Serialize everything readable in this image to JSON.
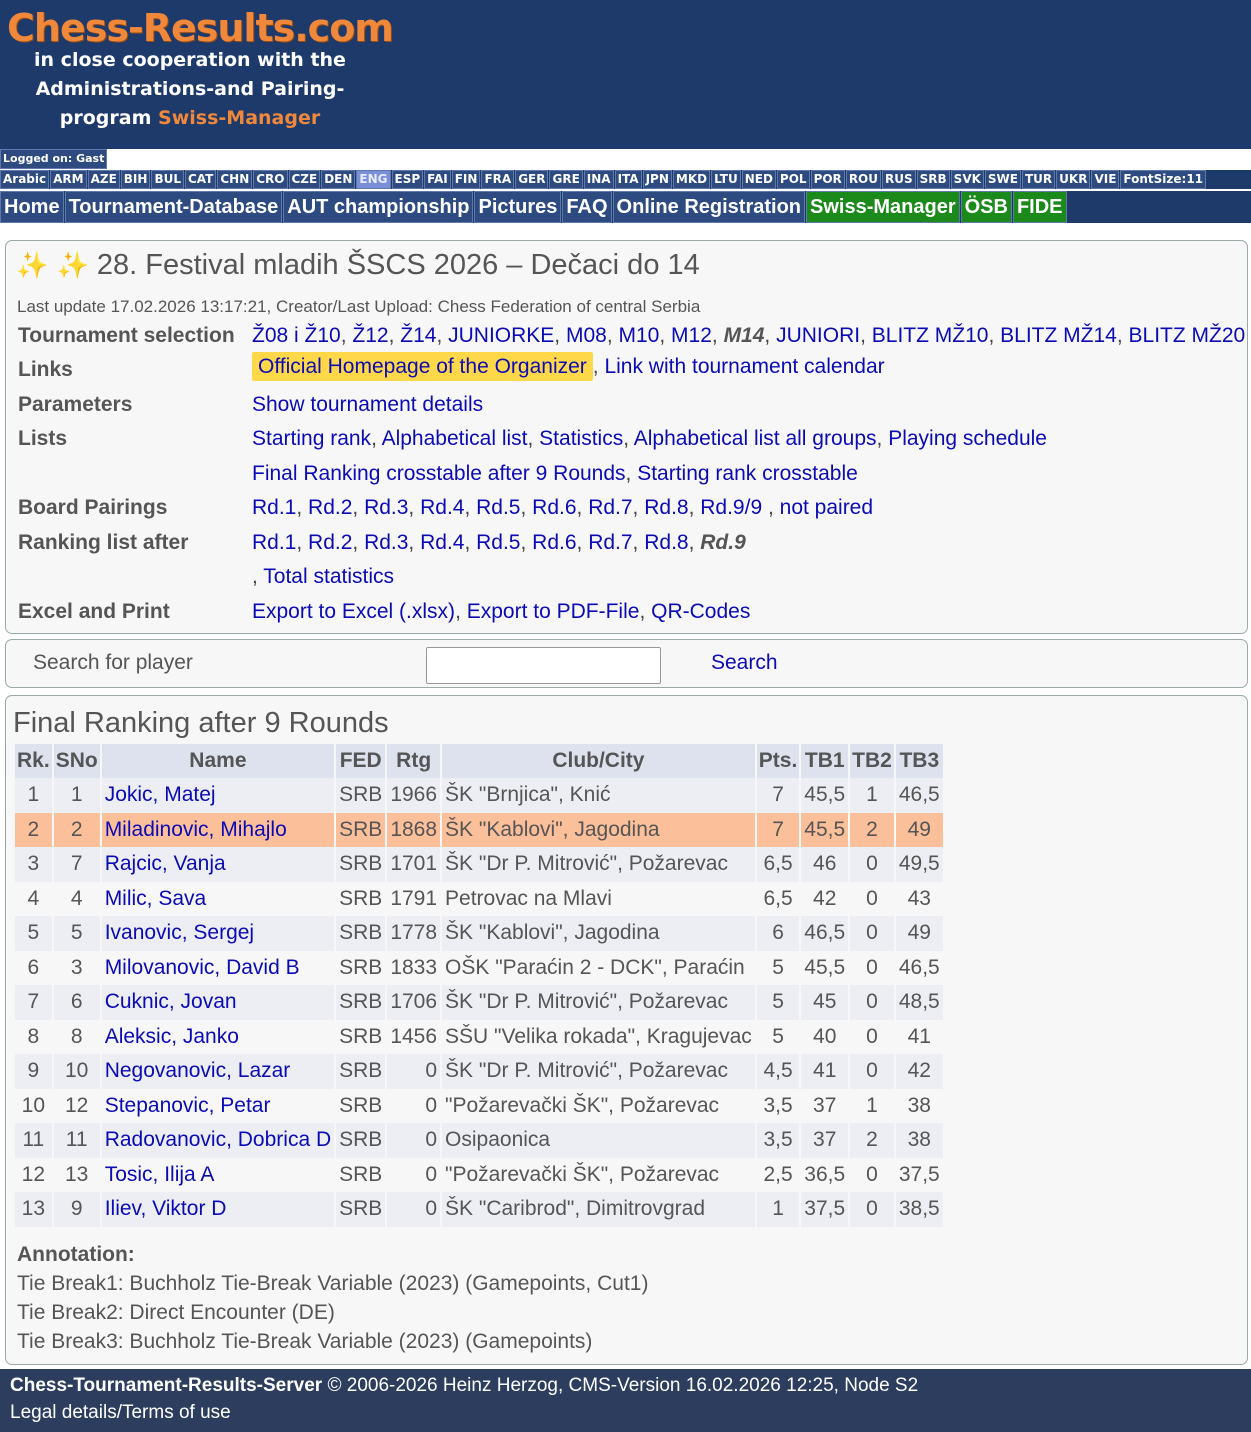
{
  "header": {
    "logo_title": "Chess-Results.com",
    "logo_line1": "in close cooperation with the",
    "logo_line2": "Administrations-and Pairing-",
    "logo_line3a": "program",
    "logo_line3b": "Swiss-Manager"
  },
  "login": "Logged on: Gast",
  "languages": [
    "Arabic",
    "ARM",
    "AZE",
    "BIH",
    "BUL",
    "CAT",
    "CHN",
    "CRO",
    "CZE",
    "DEN",
    "ENG",
    "ESP",
    "FAI",
    "FIN",
    "FRA",
    "GER",
    "GRE",
    "INA",
    "ITA",
    "JPN",
    "MKD",
    "LTU",
    "NED",
    "POL",
    "POR",
    "ROU",
    "RUS",
    "SRB",
    "SVK",
    "SWE",
    "TUR",
    "UKR",
    "VIE",
    "FontSize:11"
  ],
  "active_language": "ENG",
  "menu": [
    {
      "label": "Home",
      "green": false
    },
    {
      "label": "Tournament-Database",
      "green": false
    },
    {
      "label": "AUT championship",
      "green": false
    },
    {
      "label": "Pictures",
      "green": false
    },
    {
      "label": "FAQ",
      "green": false
    },
    {
      "label": "Online Registration",
      "green": false
    },
    {
      "label": "Swiss-Manager",
      "green": true
    },
    {
      "label": "ÖSB",
      "green": true
    },
    {
      "label": "FIDE",
      "green": true
    }
  ],
  "tournament": {
    "title": "28. Festival mladih ŠSCS 2026 – Dečaci do 14",
    "last_update": "Last update 17.02.2026 13:17:21, Creator/Last Upload: Chess Federation of central Serbia"
  },
  "info": {
    "selection_label": "Tournament selection",
    "selection": [
      "Ž08 i Ž10",
      "Ž12",
      "Ž14",
      "JUNIORKE",
      "M08",
      "M10",
      "M12",
      "M14",
      "JUNIORI",
      "BLITZ MŽ10",
      "BLITZ MŽ14",
      "BLITZ MŽ20"
    ],
    "links_label": "Links",
    "links_official": "Official Homepage of the Organizer",
    "links_calendar": "Link with tournament calendar",
    "params_label": "Parameters",
    "params_value": "Show tournament details",
    "lists_label": "Lists",
    "lists_line1": [
      "Starting rank",
      "Alphabetical list",
      "Statistics",
      "Alphabetical list all groups",
      "Playing schedule"
    ],
    "lists_line2": [
      "Final Ranking crosstable after 9 Rounds",
      "Starting rank crosstable"
    ],
    "pairings_label": "Board Pairings",
    "pairings": [
      "Rd.1",
      "Rd.2",
      "Rd.3",
      "Rd.4",
      "Rd.5",
      "Rd.6",
      "Rd.7",
      "Rd.8",
      "Rd.9/9"
    ],
    "not_paired": "not paired",
    "ranking_label": "Ranking list after",
    "ranking": [
      "Rd.1",
      "Rd.2",
      "Rd.3",
      "Rd.4",
      "Rd.5",
      "Rd.6",
      "Rd.7",
      "Rd.8"
    ],
    "ranking_current": "Rd.9",
    "total_stats": "Total statistics",
    "excel_label": "Excel and Print",
    "excel": [
      "Export to Excel (.xlsx)",
      "Export to PDF-File",
      "QR-Codes"
    ]
  },
  "search": {
    "label": "Search for player",
    "value": "",
    "button": "Search"
  },
  "results": {
    "title": "Final Ranking after 9 Rounds",
    "headers": [
      "Rk.",
      "SNo",
      "Name",
      "FED",
      "Rtg",
      "Club/City",
      "Pts.",
      "TB1",
      "TB2",
      "TB3"
    ],
    "rows": [
      [
        "1",
        "1",
        "Jokic, Matej",
        "SRB",
        "1966",
        "ŠK \"Brnjica\", Knić",
        "7",
        "45,5",
        "1",
        "46,5"
      ],
      [
        "2",
        "2",
        "Miladinovic, Mihajlo",
        "SRB",
        "1868",
        "ŠK \"Kablovi\", Jagodina",
        "7",
        "45,5",
        "2",
        "49"
      ],
      [
        "3",
        "7",
        "Rajcic, Vanja",
        "SRB",
        "1701",
        "ŠK \"Dr P. Mitrović\", Požarevac",
        "6,5",
        "46",
        "0",
        "49,5"
      ],
      [
        "4",
        "4",
        "Milic, Sava",
        "SRB",
        "1791",
        "Petrovac na Mlavi",
        "6,5",
        "42",
        "0",
        "43"
      ],
      [
        "5",
        "5",
        "Ivanovic, Sergej",
        "SRB",
        "1778",
        "ŠK \"Kablovi\", Jagodina",
        "6",
        "46,5",
        "0",
        "49"
      ],
      [
        "6",
        "3",
        "Milovanovic, David B",
        "SRB",
        "1833",
        "OŠK \"Paraćin 2 - DCK\", Paraćin",
        "5",
        "45,5",
        "0",
        "46,5"
      ],
      [
        "7",
        "6",
        "Cuknic, Jovan",
        "SRB",
        "1706",
        "ŠK \"Dr P. Mitrović\", Požarevac",
        "5",
        "45",
        "0",
        "48,5"
      ],
      [
        "8",
        "8",
        "Aleksic, Janko",
        "SRB",
        "1456",
        "SŠU \"Velika rokada\", Kragujevac",
        "5",
        "40",
        "0",
        "41"
      ],
      [
        "9",
        "10",
        "Negovanovic, Lazar",
        "SRB",
        "0",
        "ŠK \"Dr P. Mitrović\", Požarevac",
        "4,5",
        "41",
        "0",
        "42"
      ],
      [
        "10",
        "12",
        "Stepanovic, Petar",
        "SRB",
        "0",
        "\"Požarevački ŠK\", Požarevac",
        "3,5",
        "37",
        "1",
        "38"
      ],
      [
        "11",
        "11",
        "Radovanovic, Dobrica D",
        "SRB",
        "0",
        "Osipaonica",
        "3,5",
        "37",
        "2",
        "38"
      ],
      [
        "12",
        "13",
        "Tosic, Ilija A",
        "SRB",
        "0",
        "\"Požarevački ŠK\", Požarevac",
        "2,5",
        "36,5",
        "0",
        "37,5"
      ],
      [
        "13",
        "9",
        "Iliev, Viktor D",
        "SRB",
        "0",
        "ŠK \"Caribrod\", Dimitrovgrad",
        "1",
        "37,5",
        "0",
        "38,5"
      ]
    ],
    "highlight_rank": "2"
  },
  "annotation": {
    "head": "Annotation:",
    "lines": [
      "Tie Break1: Buchholz Tie-Break Variable (2023) (Gamepoints, Cut1)",
      "Tie Break2: Direct Encounter (DE)",
      "Tie Break3: Buchholz Tie-Break Variable (2023) (Gamepoints)"
    ]
  },
  "footer": {
    "server": "Chess-Tournament-Results-Server",
    "copyright": "© 2006-2026 Heinz Herzog, CMS-Version 16.02.2026 12:25, Node S2",
    "legal": "Legal details/Terms of use"
  },
  "colors": {
    "header_bg": "#1d3a6b",
    "logo_orange": "#f0883b",
    "link_blue": "#0b0bb5",
    "highlight_row": "#fbbf9a",
    "official_link_bg": "#ffd84a",
    "green_menu": "#1b8a1b"
  }
}
